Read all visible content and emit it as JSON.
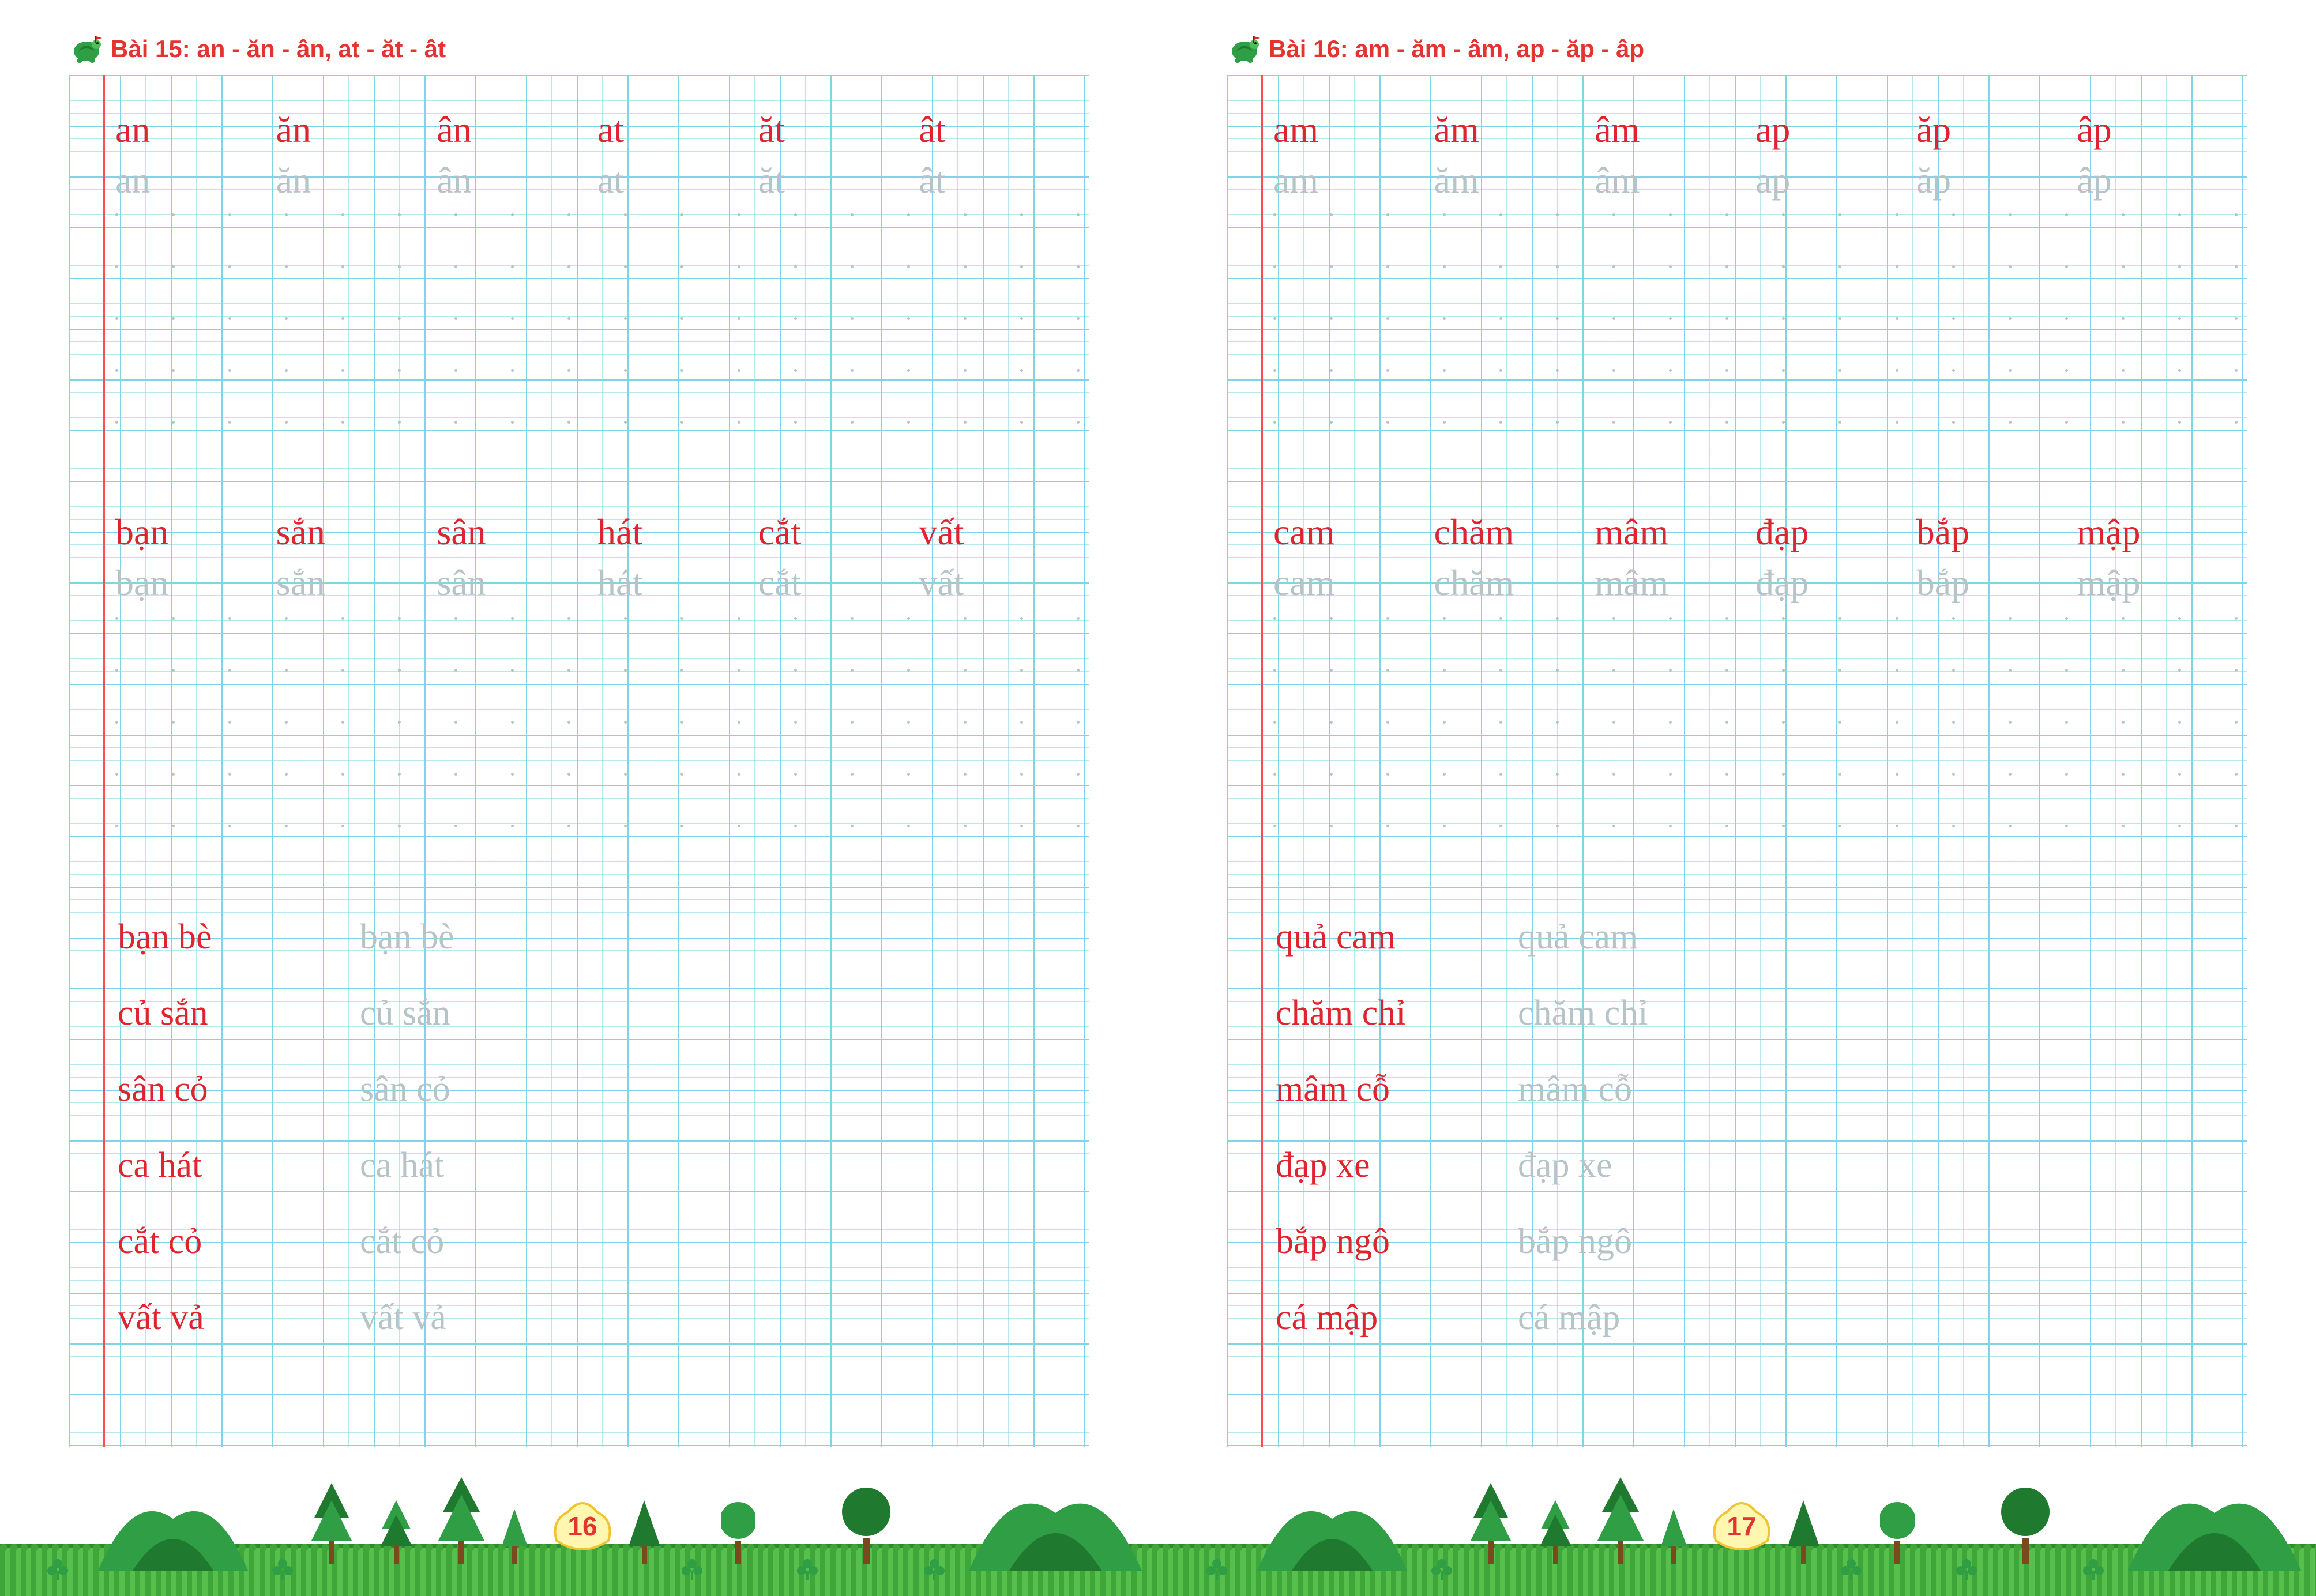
{
  "pages": [
    {
      "lesson_title": "Bài 15: an - ăn - ân, at - ăt - ât",
      "page_number": "16",
      "syllables_red": [
        "an",
        "ăn",
        "ân",
        "at",
        "ăt",
        "ât"
      ],
      "syllables_gray": [
        "an",
        "ăn",
        "ân",
        "at",
        "ăt",
        "ât"
      ],
      "words_red": [
        "bạn",
        "sắn",
        "sân",
        "hát",
        "cắt",
        "vất"
      ],
      "words_gray": [
        "bạn",
        "sắn",
        "sân",
        "hát",
        "cắt",
        "vất"
      ],
      "phrases": [
        {
          "red": "bạn bè",
          "gray": "bạn bè"
        },
        {
          "red": "củ sắn",
          "gray": "củ sắn"
        },
        {
          "red": "sân cỏ",
          "gray": "sân cỏ"
        },
        {
          "red": "ca hát",
          "gray": "ca hát"
        },
        {
          "red": "cắt cỏ",
          "gray": "cắt cỏ"
        },
        {
          "red": "vất vả",
          "gray": "vất vả"
        }
      ]
    },
    {
      "lesson_title": "Bài 16: am - ăm - âm, ap - ăp - âp",
      "page_number": "17",
      "syllables_red": [
        "am",
        "ăm",
        "âm",
        "ap",
        "ăp",
        "âp"
      ],
      "syllables_gray": [
        "am",
        "ăm",
        "âm",
        "ap",
        "ăp",
        "âp"
      ],
      "words_red": [
        "cam",
        "chăm",
        "mâm",
        "đạp",
        "bắp",
        "mập"
      ],
      "words_gray": [
        "cam",
        "chăm",
        "mâm",
        "đạp",
        "bắp",
        "mập"
      ],
      "phrases": [
        {
          "red": "quả cam",
          "gray": "quả cam"
        },
        {
          "red": "chăm chỉ",
          "gray": "chăm chỉ"
        },
        {
          "red": "mâm cỗ",
          "gray": "mâm cỗ"
        },
        {
          "red": "đạp xe",
          "gray": "đạp xe"
        },
        {
          "red": "bắp ngô",
          "gray": "bắp ngô"
        },
        {
          "red": "cá mập",
          "gray": "cá mập"
        }
      ]
    }
  ],
  "layout": {
    "row_y": {
      "syll_red": 58,
      "syll_gray": 146,
      "words_red": 756,
      "words_gray": 844,
      "phrase_start": 1460,
      "phrase_step": 132
    },
    "dot_y": [
      240,
      330,
      420,
      510,
      600,
      940,
      1030,
      1120,
      1210,
      1300
    ]
  }
}
